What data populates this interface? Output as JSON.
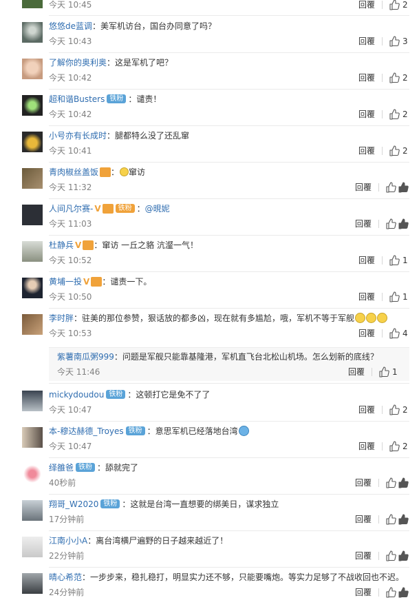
{
  "ui": {
    "reply_label": "回覆",
    "fan_badge": "铁粉"
  },
  "colors": {
    "username": "#2f6db0",
    "badge": "#5aa3d8",
    "timestamp": "#808080"
  },
  "comments": [
    {
      "username": "",
      "text": "",
      "time": "今天 10:45",
      "likes": "2"
    },
    {
      "username": "悠悠de蓝调",
      "text": "美军机访台，国台办同意了吗？",
      "time": "今天 10:43",
      "likes": "3"
    },
    {
      "username": "了解你的奥利奥",
      "text": "这是军机了吧？",
      "time": "今天 10:42",
      "likes": "2"
    },
    {
      "username": "超和谐Busters",
      "text": "谴责！",
      "time": "今天 10:42",
      "likes": "2"
    },
    {
      "username": "小号亦有长成时",
      "text": "腿都特么没了还乱窜",
      "time": "今天 10:41",
      "likes": "2"
    },
    {
      "username": "青肉椒丝盖饭",
      "text": "窜访",
      "time": "今天 11:32",
      "likes": ""
    },
    {
      "username": "人间凡尔赛-",
      "text": "@晛妮",
      "time": "今天 11:03",
      "likes": ""
    },
    {
      "username": "杜静兵",
      "text": "窜访 一丘之貉 沆瀣一气！",
      "time": "今天 10:52",
      "likes": "1"
    },
    {
      "username": "黄埔一投",
      "text": "谴责一下。",
      "time": "今天 10:50",
      "likes": "1"
    },
    {
      "username": "李时胖",
      "text": "驻美的那位参赞，狠话放的都多凶，现在就有多尴尬，哦，军机不等于军舰",
      "time": "今天 10:53",
      "likes": "4"
    },
    {
      "username": "紫薯南瓜粥999",
      "text": "问题是军舰只能靠基隆港，军机直飞台北松山机场。怎么划新的底线？",
      "time": "今天 11:46",
      "likes": "1"
    },
    {
      "username": "mickydoudou",
      "text": "这顿打它是免不了了",
      "time": "今天 10:47",
      "likes": "2"
    },
    {
      "username": "本-穆达赫德_Troyes",
      "text": "意思军机已经落地台湾",
      "time": "今天 10:47",
      "likes": "2"
    },
    {
      "username": "绎雒爸",
      "text": "舔就完了",
      "time": "40秒前",
      "likes": ""
    },
    {
      "username": "翔哥_W2020",
      "text": "这就是台湾一直想要的绑美日，谋求独立",
      "time": "17分钟前",
      "likes": ""
    },
    {
      "username": "江南小小A",
      "text": "离台湾横尸遍野的日子越来越近了！",
      "time": "22分钟前",
      "likes": ""
    },
    {
      "username": "晴心希范",
      "text": "一步步来，稳扎稳打，明显实力还不够，只能要嘴炮。等实力足够了不战收回也不迟。",
      "time": "24分钟前",
      "likes": ""
    }
  ]
}
